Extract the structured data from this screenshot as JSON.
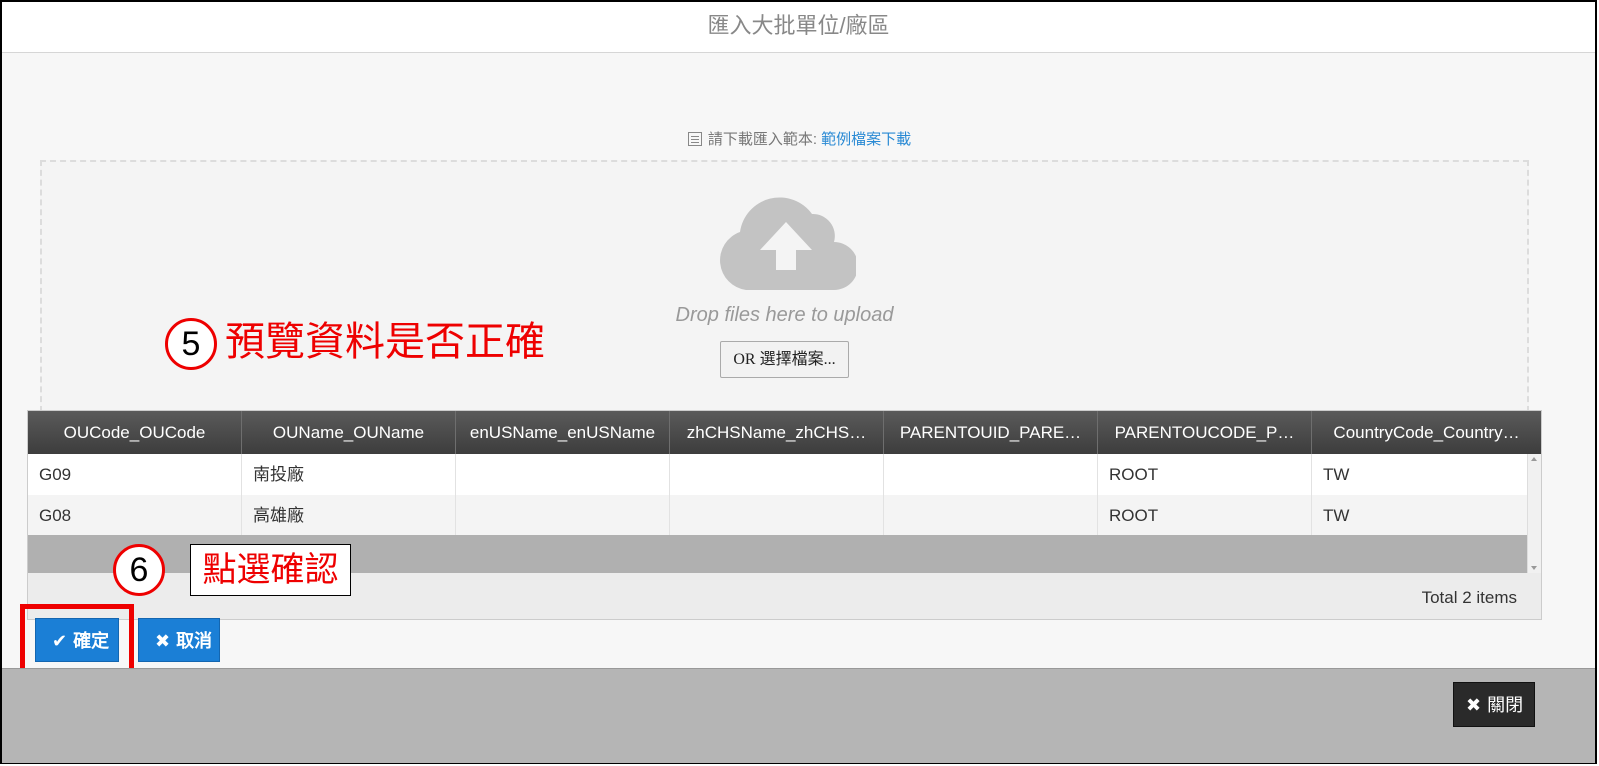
{
  "dialog": {
    "title": "匯入大批單位/廠區"
  },
  "template_hint": {
    "label": "請下載匯入範本:",
    "link": "範例檔案下載"
  },
  "dropzone": {
    "text": "Drop files here to upload",
    "select_button": "OR 選擇檔案..."
  },
  "annotations": {
    "step5": {
      "number": "5",
      "text": "預覽資料是否正確"
    },
    "step6": {
      "number": "6",
      "text": "點選確認"
    }
  },
  "grid": {
    "columns": [
      "OUCode_OUCode",
      "OUName_OUName",
      "enUSName_enUSName",
      "zhCHSName_zhCHS…",
      "PARENTOUID_PARE…",
      "PARENTOUCODE_P…",
      "CountryCode_Country…"
    ],
    "rows": [
      [
        "G09",
        "南投廠",
        "",
        "",
        "",
        "ROOT",
        "TW"
      ],
      [
        "G08",
        "高雄廠",
        "",
        "",
        "",
        "ROOT",
        "TW"
      ]
    ],
    "total": "Total 2 items"
  },
  "actions": {
    "confirm": "確定",
    "cancel": "取消",
    "close": "關閉"
  },
  "icons": {
    "check": "check-icon",
    "x": "x-icon",
    "cloud": "cloud-upload-icon",
    "doc": "document-icon"
  },
  "colors": {
    "primary": "#1b7fd6",
    "annotation": "#ee0000",
    "header": "#4a4a4a"
  }
}
